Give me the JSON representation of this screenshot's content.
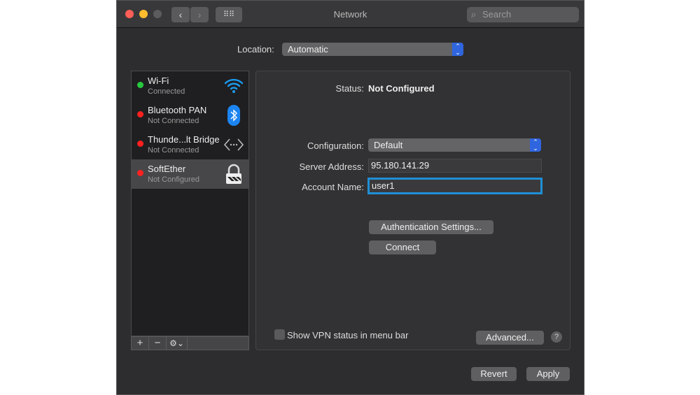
{
  "window": {
    "title": "Network",
    "search_placeholder": "Search"
  },
  "location": {
    "label": "Location:",
    "value": "Automatic"
  },
  "services": [
    {
      "name": "Wi-Fi",
      "status": "Connected",
      "dot": "#27c93f",
      "icon": "wifi-icon"
    },
    {
      "name": "Bluetooth PAN",
      "status": "Not Connected",
      "dot": "#ff2020",
      "icon": "bluetooth-icon"
    },
    {
      "name": "Thunde...lt Bridge",
      "status": "Not Connected",
      "dot": "#ff2020",
      "icon": "thunderbolt-bridge-icon"
    },
    {
      "name": "SoftEther",
      "status": "Not Configured",
      "dot": "#ff2020",
      "icon": "lock-icon",
      "selected": true
    }
  ],
  "list_toolbar": {
    "add": "+",
    "remove": "−",
    "gear": "⚙⌄"
  },
  "detail": {
    "status_label": "Status:",
    "status_value": "Not Configured",
    "config_label": "Configuration:",
    "config_value": "Default",
    "server_label": "Server Address:",
    "server_value": "95.180.141.29",
    "account_label": "Account Name:",
    "account_value": "user1",
    "auth_button": "Authentication Settings...",
    "connect_button": "Connect",
    "show_vpn_label": "Show VPN status in menu bar",
    "show_vpn_checked": false,
    "advanced_button": "Advanced...",
    "help": "?"
  },
  "footer": {
    "revert": "Revert",
    "apply": "Apply"
  },
  "colors": {
    "accent": "#2f65de",
    "focus": "#1f8fd6"
  }
}
